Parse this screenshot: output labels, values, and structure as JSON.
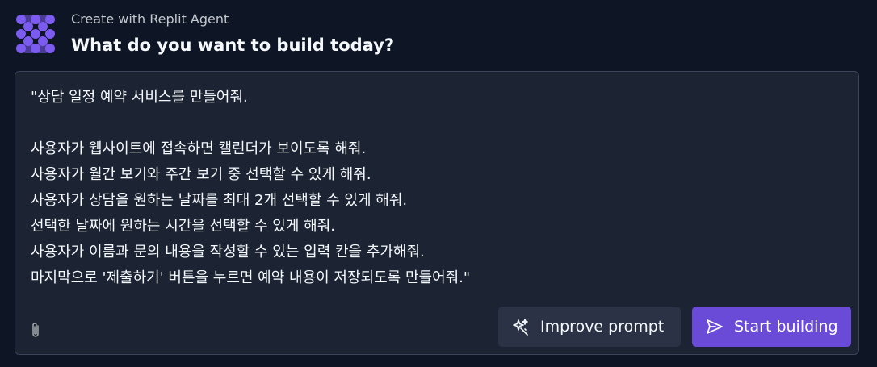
{
  "header": {
    "subtitle": "Create with Replit Agent",
    "title": "What do you want to build today?"
  },
  "prompt": {
    "lines": [
      "\"상담 일정 예약 서비스를 만들어줘.",
      "",
      "사용자가 웹사이트에 접속하면 캘린더가 보이도록 해줘.",
      "사용자가 월간 보기와 주간 보기 중 선택할 수 있게 해줘.",
      "사용자가 상담을 원하는 날짜를 최대 2개 선택할 수 있게 해줘.",
      "선택한 날짜에 원하는 시간을 선택할 수 있게 해줘.",
      "사용자가 이름과 문의 내용을 작성할 수 있는 입력 칸을 추가해줘.",
      "마지막으로 '제출하기' 버튼을 누르면 예약 내용이 저장되도록 만들어줘.\""
    ]
  },
  "actions": {
    "improve_label": "Improve prompt",
    "start_label": "Start building"
  },
  "icons": {
    "logo": "replit-agent-logo-icon",
    "attach": "paperclip-icon",
    "improve": "sparkle-wand-icon",
    "start": "send-arrow-icon"
  },
  "colors": {
    "background": "#0e1525",
    "panel": "#1c2333",
    "panel_border": "#3c445c",
    "accent": "#6a4bd8",
    "logo": "#7c5cf0",
    "secondary_button": "#2b3245"
  }
}
